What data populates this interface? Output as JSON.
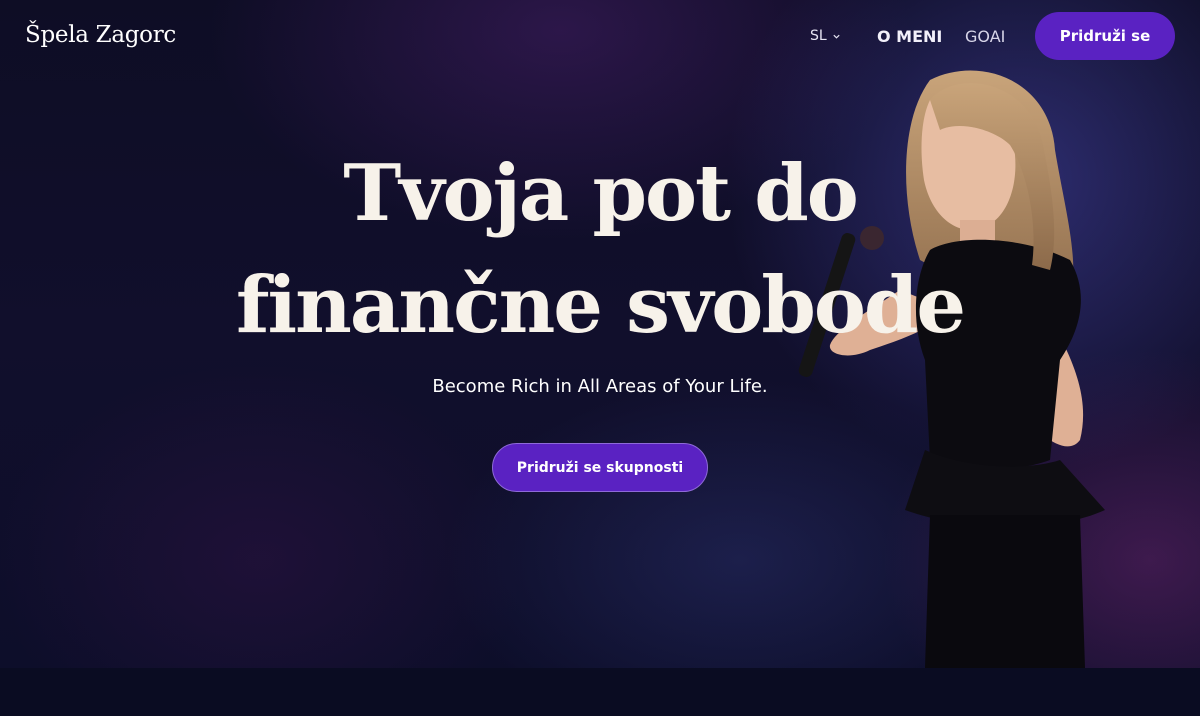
{
  "header": {
    "logo": "Špela Zagorc",
    "language": "SL",
    "nav": [
      {
        "label": "O MENI"
      },
      {
        "label": "GOAI"
      }
    ],
    "join_button": "Pridruži se"
  },
  "hero": {
    "headline_line1": "Tvoja pot do",
    "headline_line2": "finančne svobode",
    "subtitle": "Become Rich in All Areas of Your Life.",
    "cta_button": "Pridruži se skupnosti"
  },
  "colors": {
    "accent": "#5a22c2",
    "background": "#0e0d25",
    "headline": "#f7f2ea"
  },
  "icons": {
    "language_dropdown": "chevron-down-icon"
  }
}
